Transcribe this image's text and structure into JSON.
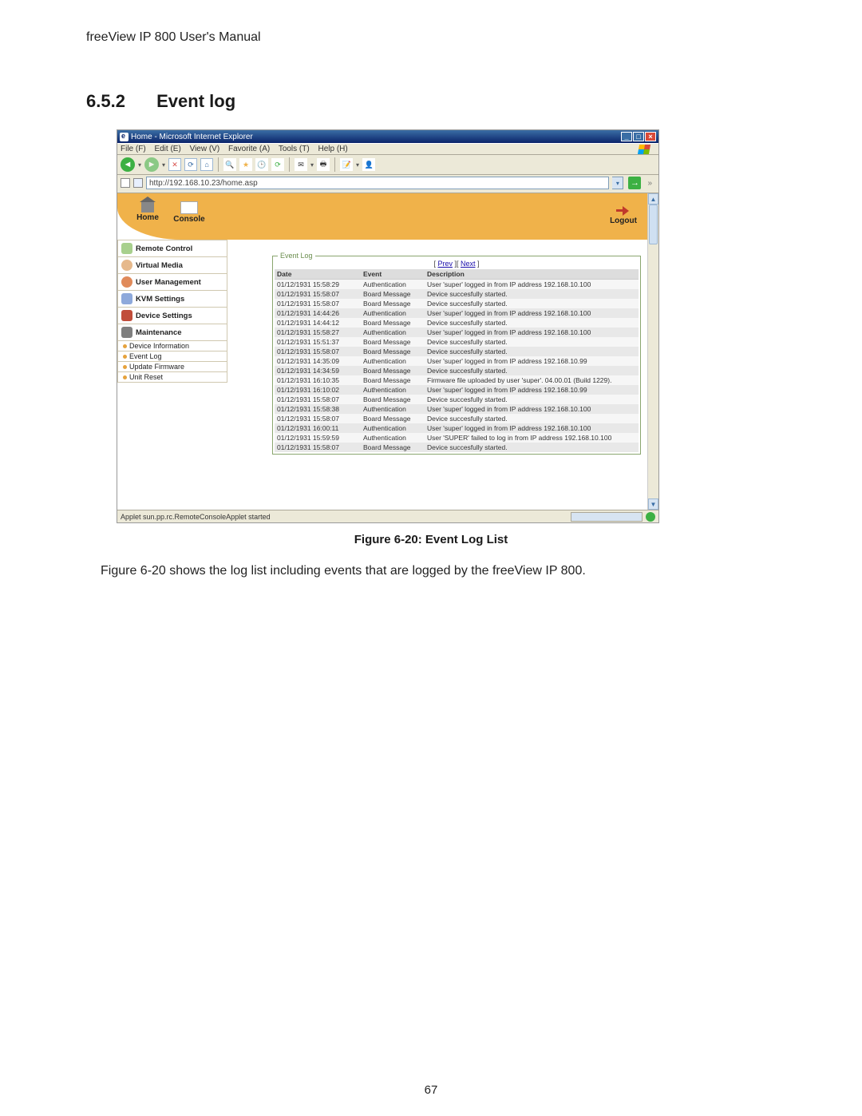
{
  "doc": {
    "header": "freeView IP 800 User's Manual",
    "section_no": "6.5.2",
    "section_title": "Event log",
    "figure_caption": "Figure 6-20: Event Log List",
    "body": "Figure 6-20 shows the log list including events that are logged by the freeView IP 800.",
    "page_number": "67"
  },
  "window": {
    "title": "Home - Microsoft Internet Explorer",
    "menus": {
      "file": "File (F)",
      "edit": "Edit (E)",
      "view": "View (V)",
      "favorite": "Favorite (A)",
      "tools": "Tools (T)",
      "help": "Help (H)"
    },
    "address": "http://192.168.10.23/home.asp",
    "status": "Applet sun.pp.rc.RemoteConsoleApplet started"
  },
  "app": {
    "nav_home": "Home",
    "nav_console": "Console",
    "nav_logout": "Logout",
    "sidebar": {
      "remote_control": "Remote Control",
      "virtual_media": "Virtual Media",
      "user_management": "User Management",
      "kvm_settings": "KVM Settings",
      "device_settings": "Device Settings",
      "maintenance": "Maintenance",
      "device_information": "Device Information",
      "event_log": "Event Log",
      "update_firmware": "Update Firmware",
      "unit_reset": "Unit Reset"
    },
    "eventlog": {
      "title": "Event Log",
      "prev": "Prev",
      "next": "Next",
      "headers": {
        "date": "Date",
        "event": "Event",
        "description": "Description"
      },
      "rows": [
        {
          "date": "01/12/1931 15:58:29",
          "event": "Authentication",
          "desc": "User 'super' logged in from IP address 192.168.10.100"
        },
        {
          "date": "01/12/1931 15:58:07",
          "event": "Board Message",
          "desc": "Device succesfully started."
        },
        {
          "date": "01/12/1931 15:58:07",
          "event": "Board Message",
          "desc": "Device succesfully started."
        },
        {
          "date": "01/12/1931 14:44:26",
          "event": "Authentication",
          "desc": "User 'super' logged in from IP address 192.168.10.100"
        },
        {
          "date": "01/12/1931 14:44:12",
          "event": "Board Message",
          "desc": "Device succesfully started."
        },
        {
          "date": "01/12/1931 15:58:27",
          "event": "Authentication",
          "desc": "User 'super' logged in from IP address 192.168.10.100"
        },
        {
          "date": "01/12/1931 15:51:37",
          "event": "Board Message",
          "desc": "Device succesfully started."
        },
        {
          "date": "01/12/1931 15:58:07",
          "event": "Board Message",
          "desc": "Device succesfully started."
        },
        {
          "date": "01/12/1931 14:35:09",
          "event": "Authentication",
          "desc": "User 'super' logged in from IP address 192.168.10.99"
        },
        {
          "date": "01/12/1931 14:34:59",
          "event": "Board Message",
          "desc": "Device succesfully started."
        },
        {
          "date": "01/12/1931 16:10:35",
          "event": "Board Message",
          "desc": "Firmware file uploaded by user 'super'. 04.00.01 (Build 1229)."
        },
        {
          "date": "01/12/1931 16:10:02",
          "event": "Authentication",
          "desc": "User 'super' logged in from IP address 192.168.10.99"
        },
        {
          "date": "01/12/1931 15:58:07",
          "event": "Board Message",
          "desc": "Device succesfully started."
        },
        {
          "date": "01/12/1931 15:58:38",
          "event": "Authentication",
          "desc": "User 'super' logged in from IP address 192.168.10.100"
        },
        {
          "date": "01/12/1931 15:58:07",
          "event": "Board Message",
          "desc": "Device succesfully started."
        },
        {
          "date": "01/12/1931 16:00:11",
          "event": "Authentication",
          "desc": "User 'super' logged in from IP address 192.168.10.100"
        },
        {
          "date": "01/12/1931 15:59:59",
          "event": "Authentication",
          "desc": "User 'SUPER' failed to log in from IP address 192.168.10.100"
        },
        {
          "date": "01/12/1931 15:58:07",
          "event": "Board Message",
          "desc": "Device succesfully started."
        }
      ]
    }
  }
}
